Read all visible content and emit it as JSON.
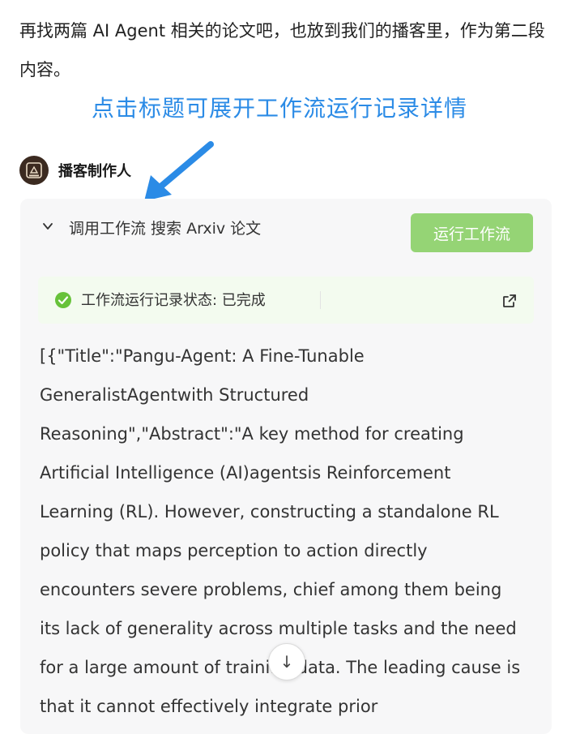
{
  "user_message": "再找两篇 AI Agent 相关的论文吧，也放到我们的播客里，作为第二段内容。",
  "annotation": "点击标题可展开工作流运行记录详情",
  "agent": {
    "name": "播客制作人",
    "avatar_icon": "podcast-logo-icon"
  },
  "workflow": {
    "title": "调用工作流 搜索 Arxiv 论文",
    "run_button": "运行工作流",
    "status": "工作流运行记录状态: 已完成",
    "result_text": "[{\"Title\":\"Pangu-Agent: A Fine-Tunable GeneralistAgentwith Structured Reasoning\",\"Abstract\":\"A key method for creating Artificial Intelligence (AI)agentsis Reinforcement Learning (RL). However, constructing a standalone RL policy that maps perception to action directly encounters severe problems, chief among them being its lack of generality across multiple tasks and the need for a large amount of training data. The leading cause is that it cannot effectively integrate prior"
  },
  "scroll_button": "↓",
  "colors": {
    "accent_blue": "#2b8be6",
    "run_button_green": "#95d475",
    "success_green": "#67c23a"
  }
}
